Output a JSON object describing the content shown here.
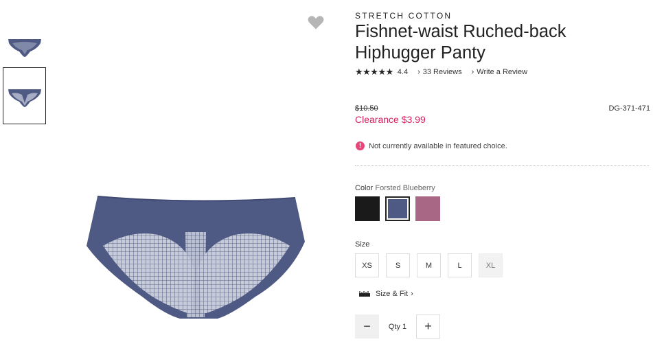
{
  "product": {
    "brand": "STRETCH COTTON",
    "title": "Fishnet-waist Ruched-back Hiphugger Panty",
    "rating_stars": "★★★★★",
    "rating_value": "4.4",
    "reviews_label": "33 Reviews",
    "write_review_label": "Write a Review",
    "original_price": "$10.50",
    "clearance_price": "Clearance $3.99",
    "sku": "DG-371-471",
    "availability_notice": "Not currently available in featured choice."
  },
  "color": {
    "label": "Color",
    "selected_name": "Forsted Blueberry",
    "swatches": [
      {
        "name": "black",
        "hex": "#1a1a1a"
      },
      {
        "name": "forsted-blueberry",
        "hex": "#4f5a84"
      },
      {
        "name": "mauve",
        "hex": "#a86784"
      }
    ]
  },
  "size": {
    "label": "Size",
    "options": [
      "XS",
      "S",
      "M",
      "L",
      "XL"
    ],
    "size_fit_label": "Size & Fit"
  },
  "quantity": {
    "label": "Qty 1",
    "minus": "−",
    "plus": "+"
  },
  "icons": {
    "wishlist": "heart-icon",
    "notice": "alert-icon",
    "ruler": "ruler-icon"
  },
  "colors": {
    "accent": "#d61f5a",
    "product": "#4f5a84"
  }
}
